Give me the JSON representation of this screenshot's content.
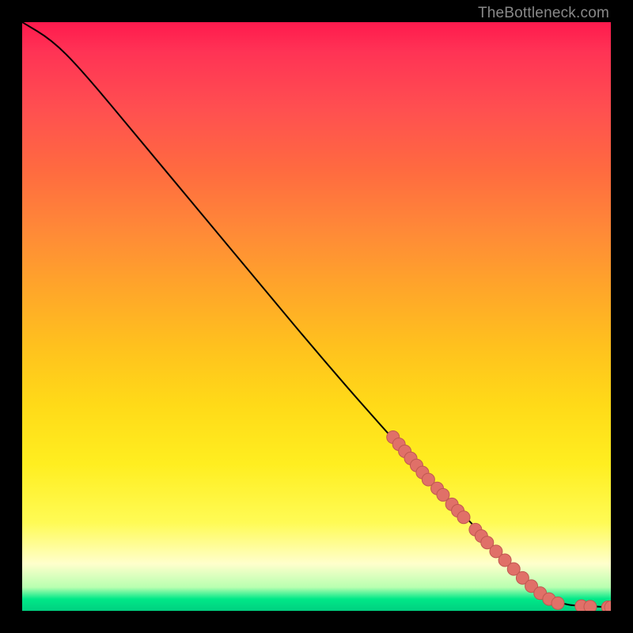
{
  "watermark": "TheBottleneck.com",
  "chart_data": {
    "type": "line",
    "title": "",
    "xlabel": "",
    "ylabel": "",
    "xlim": [
      0,
      100
    ],
    "ylim": [
      0,
      100
    ],
    "curve": [
      {
        "x": 0,
        "y": 100
      },
      {
        "x": 5,
        "y": 97
      },
      {
        "x": 10,
        "y": 92
      },
      {
        "x": 20,
        "y": 80
      },
      {
        "x": 30,
        "y": 68
      },
      {
        "x": 40,
        "y": 56
      },
      {
        "x": 50,
        "y": 44
      },
      {
        "x": 60,
        "y": 32.5
      },
      {
        "x": 70,
        "y": 21.5
      },
      {
        "x": 80,
        "y": 11
      },
      {
        "x": 88,
        "y": 3
      },
      {
        "x": 92,
        "y": 1
      },
      {
        "x": 96,
        "y": 0.8
      },
      {
        "x": 100,
        "y": 0.6
      }
    ],
    "points": [
      {
        "x": 63,
        "y": 29.5
      },
      {
        "x": 64,
        "y": 28.3
      },
      {
        "x": 65,
        "y": 27.1
      },
      {
        "x": 66,
        "y": 25.9
      },
      {
        "x": 67,
        "y": 24.7
      },
      {
        "x": 68,
        "y": 23.5
      },
      {
        "x": 69,
        "y": 22.3
      },
      {
        "x": 70.5,
        "y": 20.8
      },
      {
        "x": 71.5,
        "y": 19.7
      },
      {
        "x": 73,
        "y": 18.1
      },
      {
        "x": 74,
        "y": 17.0
      },
      {
        "x": 75,
        "y": 15.9
      },
      {
        "x": 77,
        "y": 13.8
      },
      {
        "x": 78,
        "y": 12.7
      },
      {
        "x": 79,
        "y": 11.6
      },
      {
        "x": 80.5,
        "y": 10.1
      },
      {
        "x": 82,
        "y": 8.6
      },
      {
        "x": 83.5,
        "y": 7.1
      },
      {
        "x": 85,
        "y": 5.6
      },
      {
        "x": 86.5,
        "y": 4.2
      },
      {
        "x": 88,
        "y": 3.0
      },
      {
        "x": 89.5,
        "y": 2.0
      },
      {
        "x": 91,
        "y": 1.3
      },
      {
        "x": 95,
        "y": 0.8
      },
      {
        "x": 96.5,
        "y": 0.7
      },
      {
        "x": 99.5,
        "y": 0.6
      },
      {
        "x": 100,
        "y": 0.6
      }
    ]
  }
}
